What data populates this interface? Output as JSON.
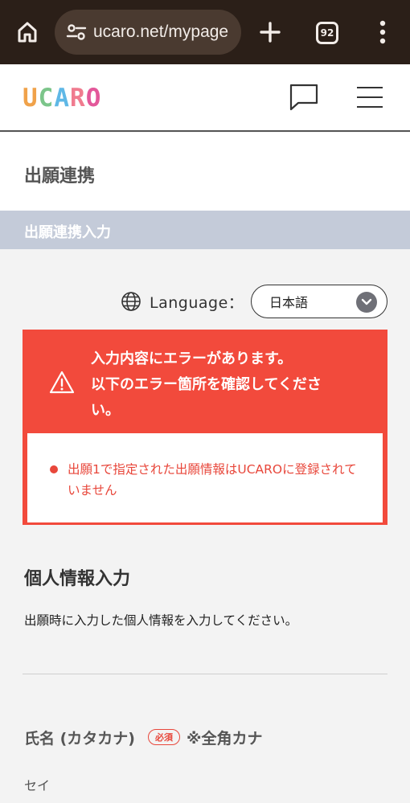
{
  "browser": {
    "url": "ucaro.net/mypage",
    "tab_count": "92"
  },
  "header": {
    "logo_letters": [
      {
        "char": "U",
        "color": "#f0a24a"
      },
      {
        "char": "C",
        "color": "#7cc58a"
      },
      {
        "char": "A",
        "color": "#5fb8e6"
      },
      {
        "char": "R",
        "color": "#f07b8f"
      },
      {
        "char": "O",
        "color": "#e3589a"
      }
    ]
  },
  "page": {
    "title": "出願連携",
    "section_title": "出願連携入力"
  },
  "language": {
    "label": "Language：",
    "selected": "日本語"
  },
  "error": {
    "lines": [
      "入力内容にエラーがあります。",
      "以下のエラー箇所を確認してくださ",
      "い。"
    ],
    "items": [
      "出願1で指定された出願情報はUCAROに登録されていません"
    ]
  },
  "personal": {
    "title": "個人情報入力",
    "description": "出願時に入力した個人情報を入力してください。",
    "name_label": "氏名 (カタカナ)",
    "required_badge": "必須",
    "name_note": "※全角カナ",
    "sei_label": "セイ"
  },
  "colors": {
    "error_red": "#f24a3c",
    "section_bar": "#c4cbd9",
    "browser_bar": "#2b1f18"
  }
}
